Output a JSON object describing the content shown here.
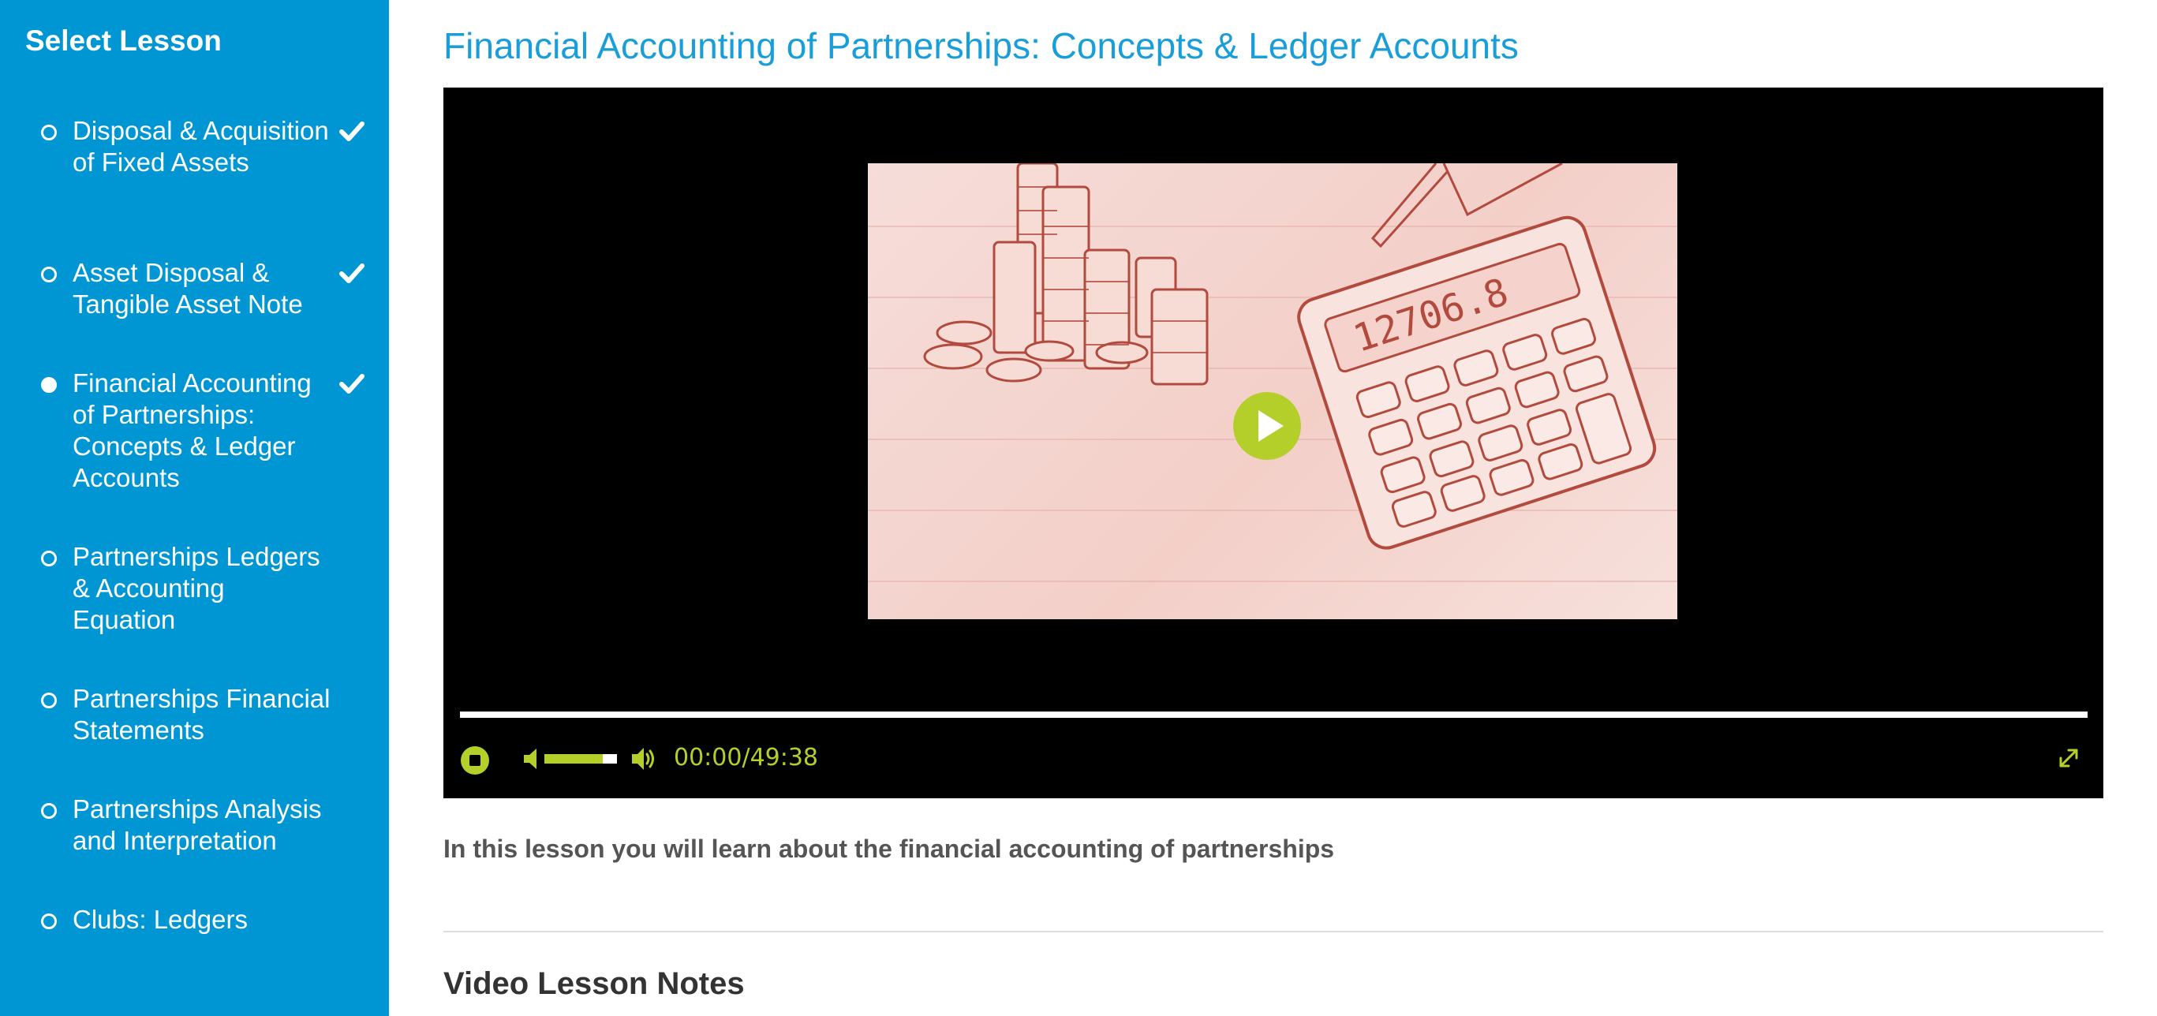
{
  "sidebar": {
    "title": "Select Lesson",
    "items": [
      {
        "label": "Disposal & Acquisition of Fixed Assets",
        "completed": true,
        "selected": false
      },
      {
        "label": "Asset Disposal & Tangible Asset Note",
        "completed": true,
        "selected": false
      },
      {
        "label": "Financial Accounting of Partnerships: Concepts & Ledger Accounts",
        "completed": true,
        "selected": true
      },
      {
        "label": "Partnerships Ledgers & Accounting Equation",
        "completed": false,
        "selected": false
      },
      {
        "label": "Partnerships Financial Statements",
        "completed": false,
        "selected": false
      },
      {
        "label": "Partnerships Analysis and Interpretation",
        "completed": false,
        "selected": false
      },
      {
        "label": "Clubs: Ledgers",
        "completed": false,
        "selected": false
      }
    ]
  },
  "main": {
    "lesson_title": "Financial Accounting of Partnerships: Concepts & Ledger Accounts",
    "description": "In this lesson you will learn about the financial accounting of partnerships",
    "notes_heading": "Video Lesson Notes"
  },
  "player": {
    "time": "00:00/49:38",
    "progress": 0,
    "volume": 0.8,
    "calculator_display": "12706.8",
    "colors": {
      "accent": "#b5cf2a",
      "background": "#000000",
      "sketch": "#b24a3e"
    },
    "icons": [
      "play-icon",
      "stop-icon",
      "volume-mute-icon",
      "volume-max-icon",
      "fullscreen-icon"
    ]
  },
  "colors": {
    "sidebar": "#0096d3",
    "title": "#1a9ed9",
    "text": "#555555"
  }
}
